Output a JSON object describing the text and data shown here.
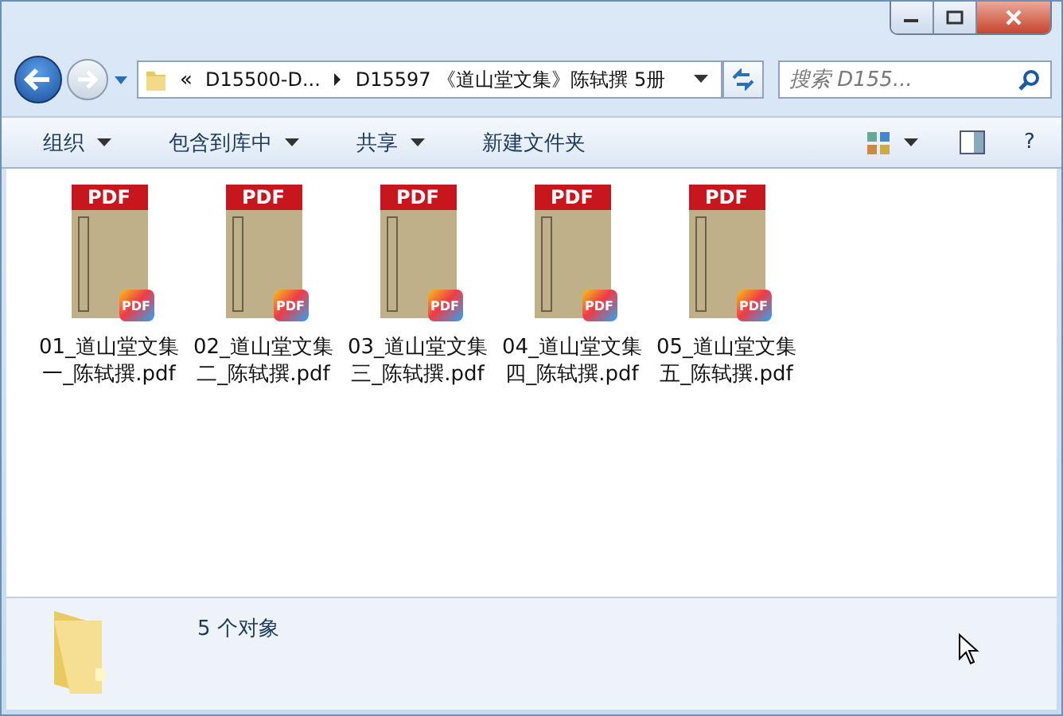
{
  "address": {
    "overflow": "«",
    "crumbs": [
      "D15500-D...",
      "D15597 《道山堂文集》陈轼撰 5册"
    ]
  },
  "search": {
    "placeholder": "搜索 D155..."
  },
  "toolbar": {
    "items": [
      {
        "label": "组织",
        "dropdown": true
      },
      {
        "label": "包含到库中",
        "dropdown": true
      },
      {
        "label": "共享",
        "dropdown": true
      },
      {
        "label": "新建文件夹",
        "dropdown": false
      }
    ],
    "help": "?"
  },
  "files": [
    {
      "name": "01_道山堂文集一_陈轼撰.pdf",
      "cover_label": "PDF",
      "badge": "PDF"
    },
    {
      "name": "02_道山堂文集二_陈轼撰.pdf",
      "cover_label": "PDF",
      "badge": "PDF"
    },
    {
      "name": "03_道山堂文集三_陈轼撰.pdf",
      "cover_label": "PDF",
      "badge": "PDF"
    },
    {
      "name": "04_道山堂文集四_陈轼撰.pdf",
      "cover_label": "PDF",
      "badge": "PDF"
    },
    {
      "name": "05_道山堂文集五_陈轼撰.pdf",
      "cover_label": "PDF",
      "badge": "PDF"
    }
  ],
  "status_bar": {
    "count": "5 个对象"
  }
}
